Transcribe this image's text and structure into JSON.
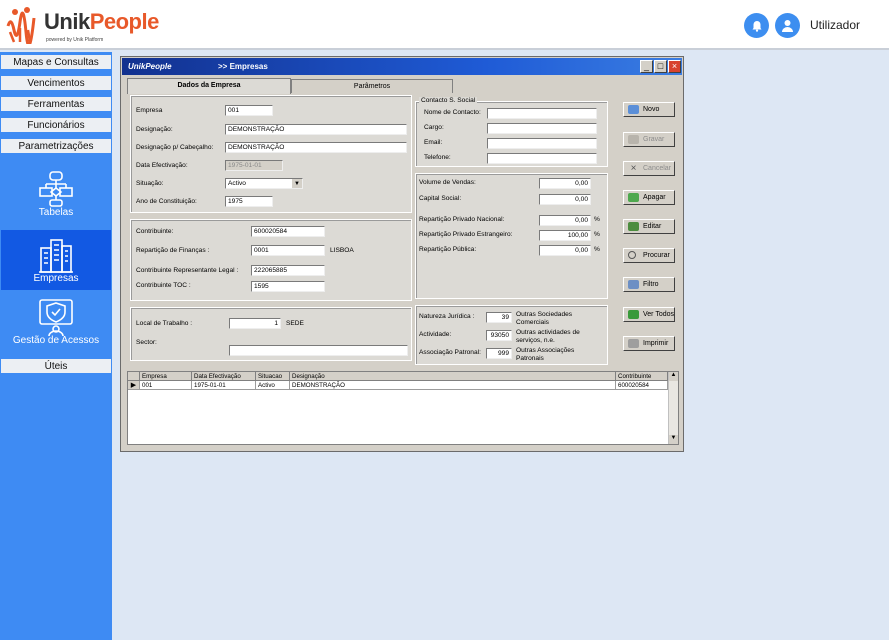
{
  "header": {
    "brand_part1": "Unik",
    "brand_part2": "People",
    "tagline": "powered by Unik Platform",
    "user": "Utilizador"
  },
  "sidebar": {
    "menus": [
      "Mapas e Consultas",
      "Vencimentos",
      "Ferramentas",
      "Funcionários",
      "Parametrizações"
    ],
    "tiles": [
      "Tabelas",
      "Empresas",
      "Gestão de Acessos"
    ],
    "uteis": "Úteis"
  },
  "window": {
    "logo": "UnikPeople",
    "title": ">> Empresas",
    "tabs": [
      "Dados da Empresa",
      "Parâmetros"
    ]
  },
  "company": {
    "empresa": {
      "label": "Empresa",
      "value": "001"
    },
    "designacao": {
      "label": "Designação:",
      "value": "DEMONSTRAÇÃO"
    },
    "designacao_cab": {
      "label": "Designação p/ Cabeçalho:",
      "value": "DEMONSTRAÇÃO"
    },
    "data_efectivacao": {
      "label": "Data Efectivação:",
      "value": "1975-01-01"
    },
    "situacao": {
      "label": "Situação:",
      "value": "Activo"
    },
    "ano": {
      "label": "Ano de Constituição:",
      "value": "1975"
    }
  },
  "fiscal": {
    "contribuinte": {
      "label": "Contribuinte:",
      "value": "600020584"
    },
    "financas": {
      "label": "Repartição de Finanças :",
      "value": "0001",
      "name": "LISBOA"
    },
    "representante": {
      "label": "Contribuinte Representante Legal :",
      "value": "222065885"
    },
    "toc": {
      "label": "Contribuinte TOC :",
      "value": "1595"
    }
  },
  "local": {
    "local_trabalho": {
      "label": "Local de Trabalho :",
      "value": "1",
      "name": "SEDE"
    },
    "sector": {
      "label": "Sector:",
      "value": ""
    }
  },
  "contacto": {
    "title": "Contacto S. Social",
    "nome": "Nome de Contacto:",
    "cargo": "Cargo:",
    "email": "Email:",
    "telefone": "Telefone:"
  },
  "financial": {
    "volume": {
      "label": "Volume de Vendas:",
      "value": "0,00"
    },
    "capital": {
      "label": "Capital Social:",
      "value": "0,00"
    },
    "rep_nacional": {
      "label": "Repartição Privado Nacional:",
      "value": "0,00"
    },
    "rep_estrangeiro": {
      "label": "Repartição Privado Estrangeiro:",
      "value": "100,00"
    },
    "rep_publica": {
      "label": "Repartição Pública:",
      "value": "0,00"
    },
    "pct": "%"
  },
  "classification": {
    "natureza": {
      "label": "Natureza Jurídica :",
      "code": "39",
      "desc": "Outras Sociedades Comerciais"
    },
    "actividade": {
      "label": "Actividade:",
      "code": "93050",
      "desc": "Outras actividades de serviços, n.e."
    },
    "associacao": {
      "label": "Associação Patronal:",
      "code": "999",
      "desc": "Outras Associações Patronais"
    }
  },
  "buttons": [
    "Novo",
    "Gravar",
    "Cancelar",
    "Apagar",
    "Editar",
    "Procurar",
    "Filtro",
    "Ver Todos",
    "Imprimir"
  ],
  "grid": {
    "columns": [
      "Empresa",
      "Data Efectivação",
      "Situacao",
      "Designação",
      "Contribuinte"
    ],
    "rows": [
      [
        "001",
        "1975-01-01",
        "Activo",
        "DEMONSTRAÇÃO",
        "600020584"
      ]
    ]
  }
}
